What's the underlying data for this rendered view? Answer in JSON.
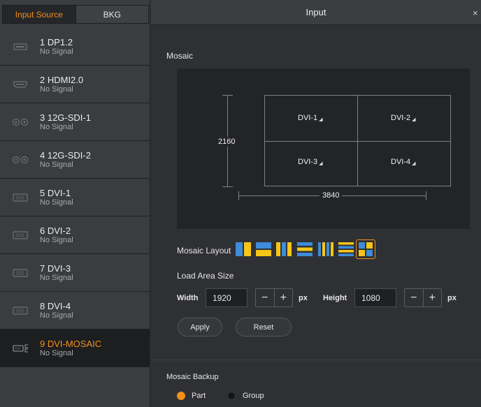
{
  "tabs": {
    "input_source": "Input Source",
    "bkg": "BKG"
  },
  "sources": [
    {
      "name": "1 DP1.2",
      "status": "No Signal",
      "icon": "dp-port-icon"
    },
    {
      "name": "2 HDMI2.0",
      "status": "No Signal",
      "icon": "hdmi-port-icon"
    },
    {
      "name": "3 12G-SDI-1",
      "status": "No Signal",
      "icon": "sdi-port-icon"
    },
    {
      "name": "4 12G-SDI-2",
      "status": "No Signal",
      "icon": "sdi-port-icon"
    },
    {
      "name": "5 DVI-1",
      "status": "No Signal",
      "icon": "dvi-port-icon"
    },
    {
      "name": "6 DVI-2",
      "status": "No Signal",
      "icon": "dvi-port-icon"
    },
    {
      "name": "7 DVI-3",
      "status": "No Signal",
      "icon": "dvi-port-icon"
    },
    {
      "name": "8 DVI-4",
      "status": "No Signal",
      "icon": "dvi-port-icon"
    },
    {
      "name": "9 DVI-MOSAIC",
      "status": "No Signal",
      "icon": "dvi-mosaic-icon",
      "selected": true
    }
  ],
  "panel": {
    "title": "Input",
    "close": "×"
  },
  "mosaic": {
    "label": "Mosaic",
    "cells": [
      "DVI-1",
      "DVI-2",
      "DVI-3",
      "DVI-4"
    ],
    "height_label": "2160",
    "width_label": "3840"
  },
  "layout": {
    "label": "Mosaic Layout",
    "options": [
      "layout-2-columns-icon",
      "layout-2-rows-icon",
      "layout-3-columns-icon",
      "layout-3-rows-icon",
      "layout-4-columns-icon",
      "layout-4-rows-icon",
      "layout-2x2-grid-icon"
    ],
    "selected_index": 6
  },
  "load_area": {
    "label": "Load Area Size",
    "width_label": "Width",
    "width_value": "1920",
    "height_label": "Height",
    "height_value": "1080",
    "unit": "px",
    "minus": "−",
    "plus": "+"
  },
  "buttons": {
    "apply": "Apply",
    "reset": "Reset"
  },
  "backup": {
    "label": "Mosaic Backup",
    "options": [
      "Part",
      "Group"
    ],
    "selected": "Part"
  },
  "colors": {
    "accent": "#f39019",
    "icon_blue": "#3d8bd9",
    "icon_yellow": "#f5c518"
  }
}
